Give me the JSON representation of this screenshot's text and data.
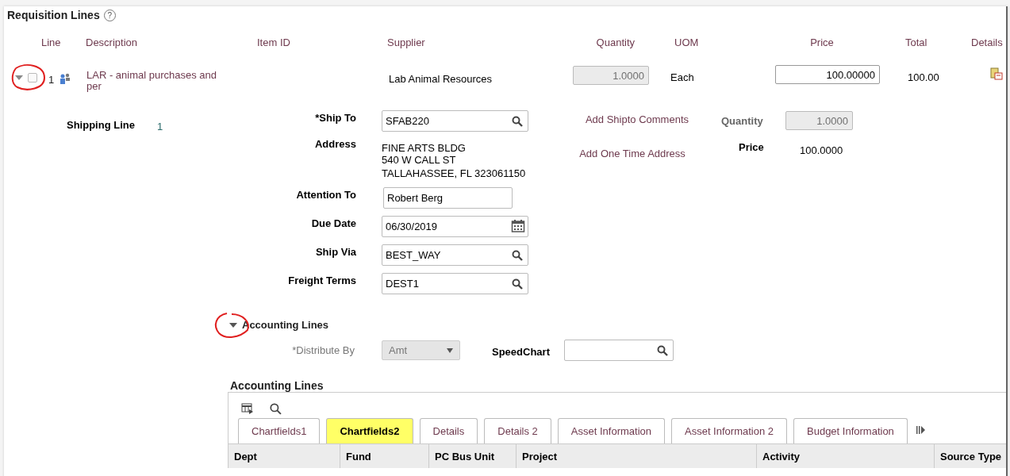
{
  "section_title": "Requisition Lines",
  "help": "?",
  "columns": [
    "Line",
    "Description",
    "Item ID",
    "Supplier",
    "Quantity",
    "UOM",
    "Price",
    "Total",
    "Details"
  ],
  "line": {
    "expanded": true,
    "checked": false,
    "number": "1",
    "description": "LAR - animal purchases and per",
    "supplier": "Lab Animal Resources",
    "quantity": "1.0000",
    "uom": "Each",
    "price": "100.00000",
    "total": "100.00"
  },
  "shipping": {
    "label": "Shipping Line",
    "number": "1",
    "fields": [
      {
        "kind": "lookup",
        "label": "*Ship To",
        "value": "SFAB220"
      },
      {
        "kind": "address",
        "label": "Address",
        "lines": [
          "FINE ARTS BLDG",
          "540 W CALL ST",
          "TALLAHASSEE, FL  323061150"
        ]
      },
      {
        "kind": "text",
        "label": "Attention To",
        "value": "Robert Berg"
      },
      {
        "kind": "date",
        "label": "Due Date",
        "value": "06/30/2019"
      },
      {
        "kind": "lookup",
        "label": "Ship Via",
        "value": "BEST_WAY"
      },
      {
        "kind": "lookup",
        "label": "Freight Terms",
        "value": "DEST1"
      }
    ],
    "links": [
      "Add Shipto Comments",
      "Add One Time Address"
    ],
    "quantity": {
      "label": "Quantity",
      "value": "1.0000"
    },
    "price": {
      "label": "Price",
      "value": "100.0000"
    }
  },
  "accounting": {
    "expanded": true,
    "title": "Accounting Lines",
    "distribute_by": {
      "label": "*Distribute By",
      "value": "Amt"
    },
    "speedchart": {
      "label": "SpeedChart"
    }
  },
  "grid": {
    "title": "Accounting Lines",
    "tabs": [
      {
        "label": "Chartfields1",
        "selected": false
      },
      {
        "label": "Chartfields2",
        "selected": true
      },
      {
        "label": "Details",
        "selected": false
      },
      {
        "label": "Details 2",
        "selected": false
      },
      {
        "label": "Asset Information",
        "selected": false
      },
      {
        "label": "Asset Information 2",
        "selected": false
      },
      {
        "label": "Budget Information",
        "selected": false
      }
    ],
    "columns": [
      "Dept",
      "Fund",
      "PC Bus Unit",
      "Project",
      "Activity",
      "Source Type"
    ]
  }
}
